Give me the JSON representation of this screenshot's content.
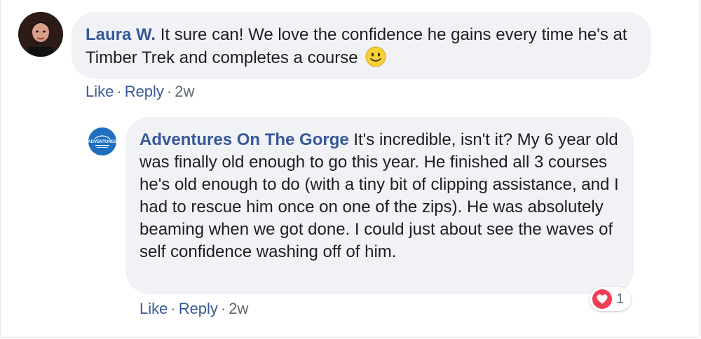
{
  "comments": [
    {
      "author": "Laura W.",
      "text": "It sure can! We love the confidence he gains every time he's at Timber Trek and completes a course",
      "actions": {
        "like": "Like",
        "reply": "Reply",
        "time": "2w"
      }
    },
    {
      "author": "Adventures On The Gorge",
      "text": "It's incredible, isn't it? My 6 year old was finally old enough to go this year. He finished all 3 courses he's old enough to do (with a tiny bit of clipping assistance, and I had to rescue him once on one of the zips). He was absolutely beaming when we got done. I could just about see the waves of self confidence washing off of him.",
      "actions": {
        "like": "Like",
        "reply": "Reply",
        "time": "2w"
      },
      "reaction": {
        "icon": "heart-icon",
        "count": "1"
      },
      "avatar_logo_text": "ADVENTURES"
    }
  ],
  "separator": "·",
  "colors": {
    "author": "#385898",
    "bubble": "#f0f2f5",
    "heart": "#f33e58",
    "meta": "#606770"
  }
}
